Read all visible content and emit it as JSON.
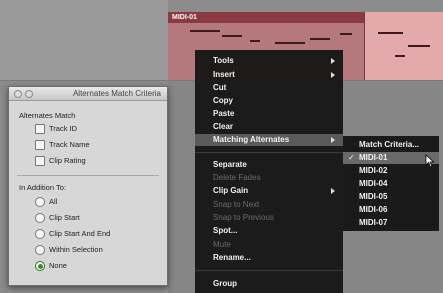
{
  "clip": {
    "name": "MIDI-01"
  },
  "match_window": {
    "title": "Alternates Match Criteria",
    "alternates_match_label": "Alternates Match",
    "checkboxes": [
      {
        "label": "Track ID",
        "checked": false
      },
      {
        "label": "Track Name",
        "checked": false
      },
      {
        "label": "Clip Rating",
        "checked": false
      }
    ],
    "in_addition_label": "In Addition To:",
    "radios": [
      {
        "label": "All",
        "selected": false
      },
      {
        "label": "Clip Start",
        "selected": false
      },
      {
        "label": "Clip Start And End",
        "selected": false
      },
      {
        "label": "Within Selection",
        "selected": false
      },
      {
        "label": "None",
        "selected": true
      }
    ]
  },
  "context_menu": {
    "items": [
      {
        "label": "Tools",
        "submenu": true,
        "enabled": true
      },
      {
        "label": "Insert",
        "submenu": true,
        "enabled": true
      },
      {
        "label": "Cut",
        "enabled": true
      },
      {
        "label": "Copy",
        "enabled": true
      },
      {
        "label": "Paste",
        "enabled": true
      },
      {
        "label": "Clear",
        "enabled": true
      },
      {
        "label": "Matching Alternates",
        "submenu": true,
        "enabled": true,
        "highlighted": true
      },
      {
        "label": "Separate",
        "enabled": true
      },
      {
        "label": "Delete Fades",
        "enabled": false
      },
      {
        "label": "Clip Gain",
        "submenu": true,
        "enabled": true
      },
      {
        "label": "Snap to Next",
        "enabled": false
      },
      {
        "label": "Snap to Previous",
        "enabled": false
      },
      {
        "label": "Spot...",
        "enabled": true
      },
      {
        "label": "Mute",
        "enabled": false
      },
      {
        "label": "Rename...",
        "enabled": true
      },
      {
        "label": "Group",
        "enabled": true
      }
    ]
  },
  "submenu": {
    "items": [
      {
        "label": "Match Criteria...",
        "checked": false
      },
      {
        "label": "MIDI-01",
        "checked": true,
        "highlighted": true
      },
      {
        "label": "MIDI-02",
        "checked": false
      },
      {
        "label": "MIDI-04",
        "checked": false
      },
      {
        "label": "MIDI-05",
        "checked": false
      },
      {
        "label": "MIDI-06",
        "checked": false
      },
      {
        "label": "MIDI-07",
        "checked": false
      }
    ]
  },
  "colors": {
    "clip_body": "#b5797d",
    "clip_title_bar": "#8a3a42",
    "menu_bg": "#141414",
    "menu_highlight": "#5a5a5a",
    "radio_selected": "#3b8a22"
  }
}
